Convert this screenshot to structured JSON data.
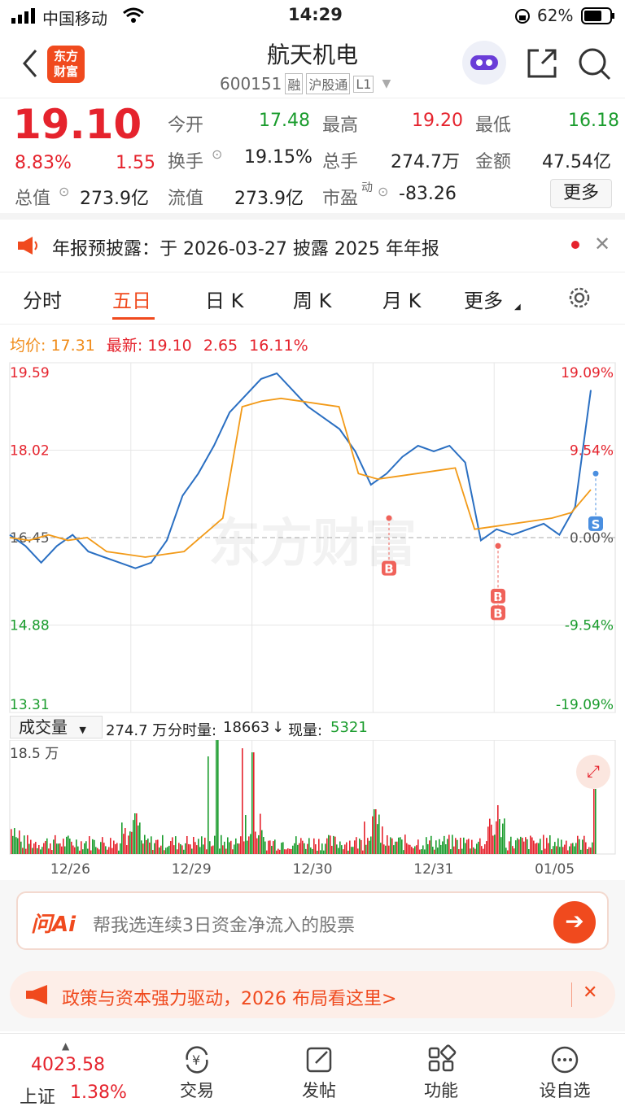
{
  "status": {
    "carrier": "中国移动",
    "time": "14:29",
    "battery": "62%"
  },
  "header": {
    "brand": "东方\n财富",
    "stock_name": "航天机电",
    "code": "600151",
    "tags": [
      "融",
      "沪股通",
      "L1"
    ]
  },
  "quote": {
    "price": "19.10",
    "pct": "8.83%",
    "change": "1.55",
    "open_label": "今开",
    "open": "17.48",
    "high_label": "最高",
    "high": "19.20",
    "low_label": "最低",
    "low": "16.18",
    "turnover_label": "换手",
    "turnover": "19.15%",
    "volume_label": "总手",
    "volume": "274.7万",
    "amount_label": "金额",
    "amount": "47.54亿",
    "mcap_label": "总值",
    "mcap": "273.9亿",
    "float_label": "流值",
    "float": "273.9亿",
    "pe_label": "市盈",
    "pe_sup": "动",
    "pe": "-83.26",
    "more": "更多"
  },
  "notice": {
    "text": "年报预披露：于 2026-03-27 披露 2025 年年报"
  },
  "tabs": {
    "items": [
      "分时",
      "五日",
      "日 K",
      "周 K",
      "月 K",
      "更多"
    ],
    "active": 1
  },
  "chartinfo": {
    "avg_label": "均价:",
    "avg": "17.31",
    "latest_label": "最新:",
    "latest": "19.10",
    "chg": "2.65",
    "pct": "16.11%"
  },
  "chart_data": {
    "type": "line",
    "x": [
      "12/26",
      "12/29",
      "12/30",
      "12/31",
      "01/05"
    ],
    "left_ticks": [
      "19.59",
      "18.02",
      "16.45",
      "14.88",
      "13.31"
    ],
    "right_ticks": [
      "19.09%",
      "9.54%",
      "0.00%",
      "-9.54%",
      "-19.09%"
    ],
    "ylim": [
      13.31,
      19.59
    ],
    "series": [
      {
        "values": [
          16.5,
          16.3,
          16.0,
          16.3,
          16.5,
          16.2,
          16.1,
          16.0,
          15.9,
          16.0,
          16.4,
          17.2,
          17.6,
          18.1,
          18.7,
          19.0,
          19.3,
          19.4,
          19.1,
          18.8,
          18.6,
          18.4,
          18.0,
          17.4,
          17.6,
          17.9,
          18.1,
          18.0,
          18.1,
          17.8,
          16.4,
          16.6,
          16.5,
          16.6,
          16.7,
          16.5,
          17.0,
          19.1
        ],
        "color": "#2a6fc2"
      },
      {
        "values": [
          16.45,
          16.4,
          16.5,
          16.4,
          16.45,
          16.2,
          16.15,
          16.1,
          16.15,
          16.2,
          16.5,
          16.8,
          18.8,
          18.9,
          18.95,
          18.9,
          18.85,
          18.8,
          17.6,
          17.5,
          17.55,
          17.6,
          17.65,
          17.7,
          16.6,
          16.65,
          16.7,
          16.75,
          16.8,
          16.9,
          17.31
        ],
        "color": "#f29a18"
      }
    ],
    "volume_label": "成交量",
    "volume_total": "274.7 万",
    "minute_vol_label": "分时量:",
    "minute_vol": "18663",
    "now_label": "现量:",
    "now": "5321",
    "vol_max": "18.5 万",
    "markers": [
      "B",
      "B",
      "B",
      "S"
    ],
    "watermark": "东方财富"
  },
  "ai": {
    "placeholder": "帮我选连续3日资金净流入的股票",
    "logo": "问Ai"
  },
  "banner": {
    "text": "政策与资本强力驱动，2026 布局看这里>"
  },
  "bottom": {
    "index_value": "4023.58",
    "index_name": "上证",
    "index_pct": "1.38%",
    "items": [
      "交易",
      "发帖",
      "功能",
      "设自选"
    ]
  }
}
